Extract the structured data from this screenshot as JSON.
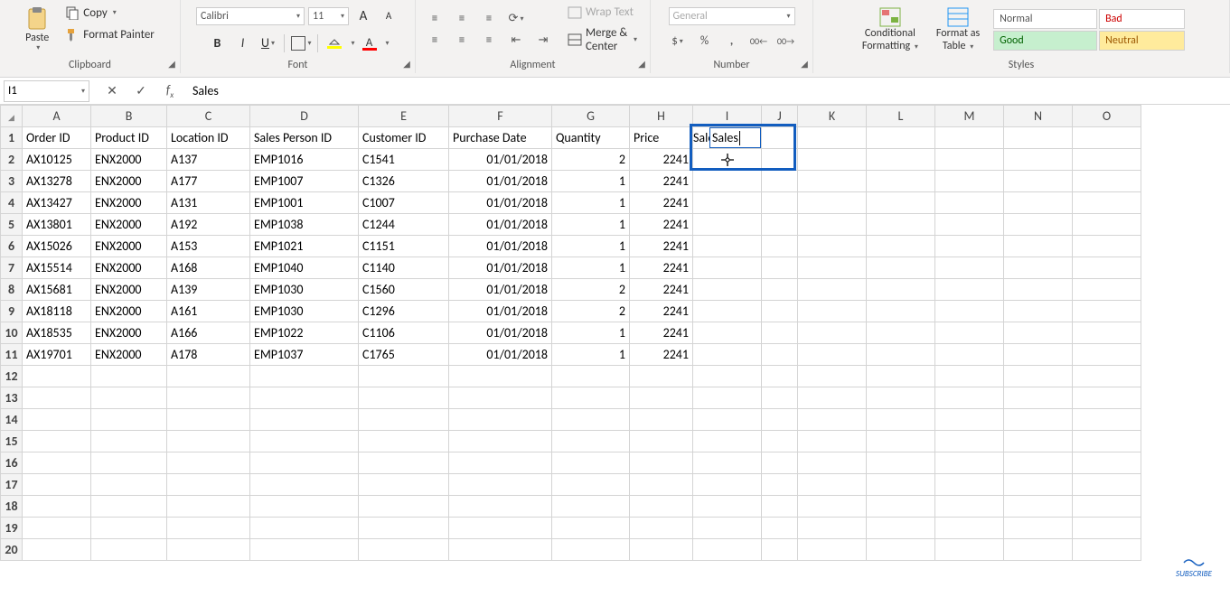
{
  "ribbon": {
    "clipboard": {
      "paste": "Paste",
      "copy": "Copy",
      "format_painter": "Format Painter",
      "label": "Clipboard"
    },
    "font": {
      "name": "Calibri",
      "size": "11",
      "label": "Font"
    },
    "alignment": {
      "wrap_text": "Wrap Text",
      "merge_center": "Merge & Center",
      "label": "Alignment"
    },
    "number": {
      "format": "General",
      "label": "Number"
    },
    "styles": {
      "conditional": "Conditional",
      "conditional2": "Formatting",
      "format_as": "Format as",
      "table": "Table",
      "normal": "Normal",
      "bad": "Bad",
      "good": "Good",
      "neutral": "Neutral",
      "label": "Styles"
    }
  },
  "name_box": "I1",
  "formula_value": "Sales",
  "active_cell": "I1",
  "columns": [
    "A",
    "B",
    "C",
    "D",
    "E",
    "F",
    "G",
    "H",
    "I",
    "J",
    "K",
    "L",
    "M",
    "N",
    "O"
  ],
  "headers": {
    "A": "Order ID",
    "B": "Product ID",
    "C": "Location ID",
    "D": "Sales Person ID",
    "E": "Customer ID",
    "F": "Purchase Date",
    "G": "Quantity",
    "H": "Price",
    "I": "Sales"
  },
  "rows": [
    {
      "A": "AX10125",
      "B": "ENX2000",
      "C": "A137",
      "D": "EMP1016",
      "E": "C1541",
      "F": "01/01/2018",
      "G": "2",
      "H": "2241"
    },
    {
      "A": "AX13278",
      "B": "ENX2000",
      "C": "A177",
      "D": "EMP1007",
      "E": "C1326",
      "F": "01/01/2018",
      "G": "1",
      "H": "2241"
    },
    {
      "A": "AX13427",
      "B": "ENX2000",
      "C": "A131",
      "D": "EMP1001",
      "E": "C1007",
      "F": "01/01/2018",
      "G": "1",
      "H": "2241"
    },
    {
      "A": "AX13801",
      "B": "ENX2000",
      "C": "A192",
      "D": "EMP1038",
      "E": "C1244",
      "F": "01/01/2018",
      "G": "1",
      "H": "2241"
    },
    {
      "A": "AX15026",
      "B": "ENX2000",
      "C": "A153",
      "D": "EMP1021",
      "E": "C1151",
      "F": "01/01/2018",
      "G": "1",
      "H": "2241"
    },
    {
      "A": "AX15514",
      "B": "ENX2000",
      "C": "A168",
      "D": "EMP1040",
      "E": "C1140",
      "F": "01/01/2018",
      "G": "1",
      "H": "2241"
    },
    {
      "A": "AX15681",
      "B": "ENX2000",
      "C": "A139",
      "D": "EMP1030",
      "E": "C1560",
      "F": "01/01/2018",
      "G": "2",
      "H": "2241"
    },
    {
      "A": "AX18118",
      "B": "ENX2000",
      "C": "A161",
      "D": "EMP1030",
      "E": "C1296",
      "F": "01/01/2018",
      "G": "2",
      "H": "2241"
    },
    {
      "A": "AX18535",
      "B": "ENX2000",
      "C": "A166",
      "D": "EMP1022",
      "E": "C1106",
      "F": "01/01/2018",
      "G": "1",
      "H": "2241"
    },
    {
      "A": "AX19701",
      "B": "ENX2000",
      "C": "A178",
      "D": "EMP1037",
      "E": "C1765",
      "F": "01/01/2018",
      "G": "1",
      "H": "2241"
    }
  ],
  "empty_row_count": 9,
  "subscribe": "SUBSCRIBE"
}
